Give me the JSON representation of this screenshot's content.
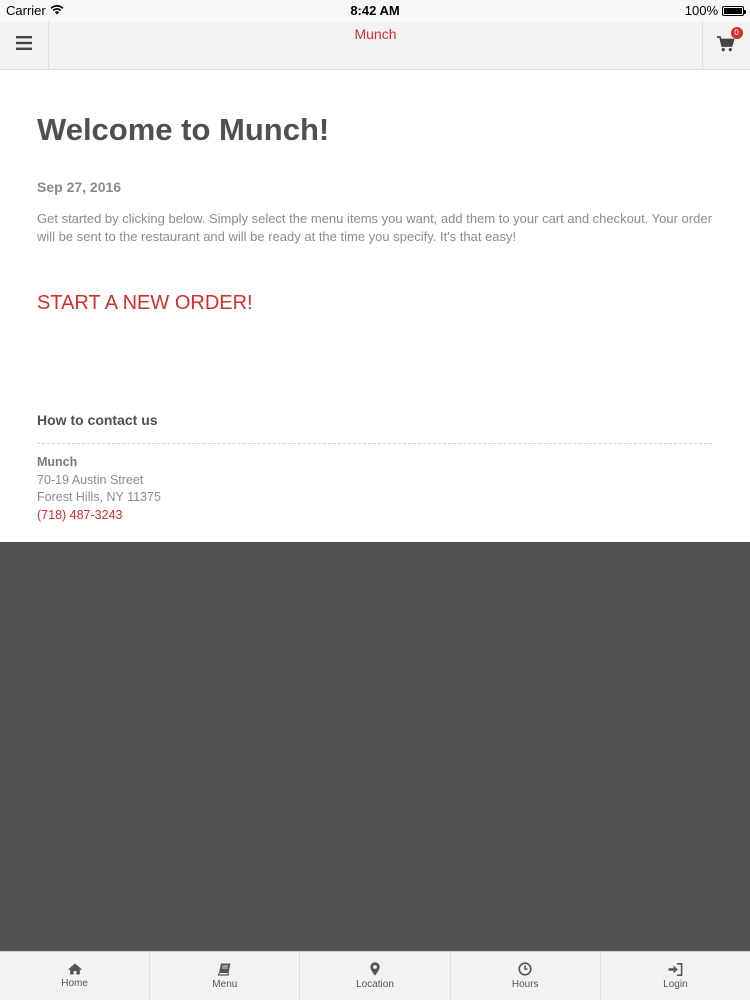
{
  "status_bar": {
    "carrier": "Carrier",
    "time": "8:42 AM",
    "battery": "100%",
    "icons": [
      "wifi-icon",
      "battery-icon"
    ]
  },
  "navbar": {
    "title": "Munch",
    "cart_count": "0",
    "icons": [
      "hamburger-menu-icon",
      "cart-icon"
    ]
  },
  "main": {
    "title": "Welcome to Munch!",
    "date": "Sep 27, 2016",
    "intro": "Get started by clicking below. Simply select the menu items you want, add them to your cart and checkout. Your order will be sent to the restaurant and will be ready at the time you specify. It's that easy!",
    "start_order_label": "START A NEW ORDER!"
  },
  "contact": {
    "heading": "How to contact us",
    "name": "Munch",
    "address_line1": "70-19 Austin Street",
    "address_line2": "Forest Hills, NY 11375",
    "phone": "(718) 487-3243"
  },
  "tabbar": {
    "tabs": [
      {
        "label": "Home",
        "icon": "home-icon"
      },
      {
        "label": "Menu",
        "icon": "book-icon"
      },
      {
        "label": "Location",
        "icon": "map-pin-icon"
      },
      {
        "label": "Hours",
        "icon": "clock-icon"
      },
      {
        "label": "Login",
        "icon": "login-icon"
      }
    ]
  },
  "colors": {
    "accent": "#d0312d",
    "heading": "#505050",
    "body_text": "#8c8c8c",
    "dark_area": "#515053",
    "bar_background": "#f2f2f2"
  }
}
